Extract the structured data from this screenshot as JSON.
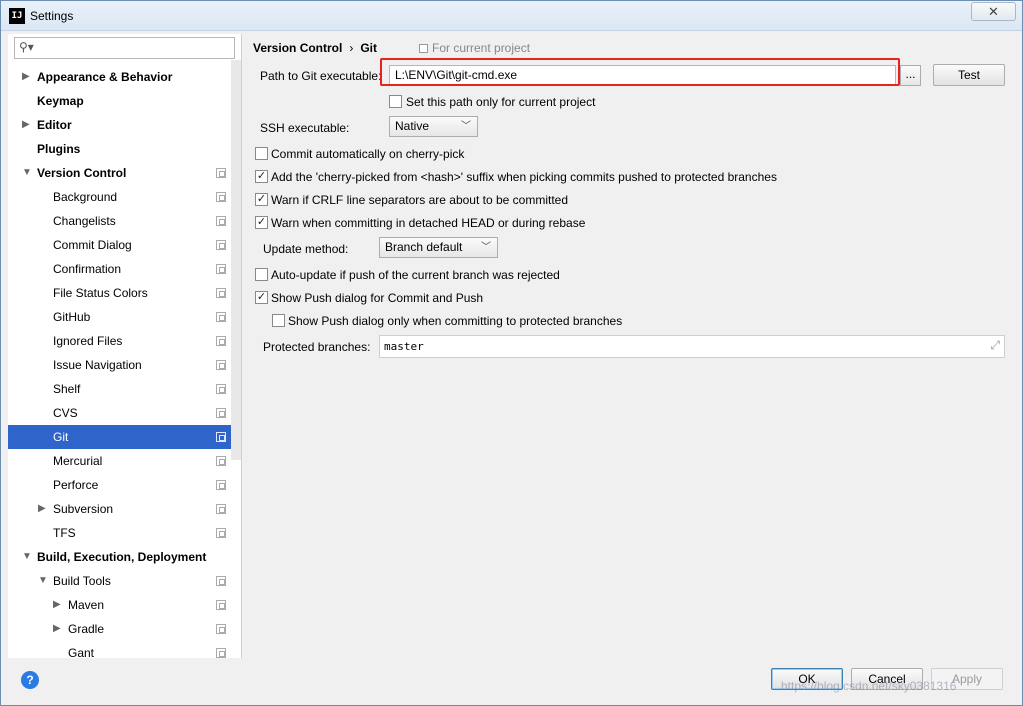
{
  "window": {
    "title": "Settings",
    "app_icon": "IJ",
    "close": "✕"
  },
  "sidebar": {
    "search_placeholder": "",
    "items": [
      {
        "label": "Appearance & Behavior",
        "bold": true,
        "arrow": "▶",
        "level": 0
      },
      {
        "label": "Keymap",
        "bold": true,
        "arrow": "",
        "level": 0
      },
      {
        "label": "Editor",
        "bold": true,
        "arrow": "▶",
        "level": 0
      },
      {
        "label": "Plugins",
        "bold": true,
        "arrow": "",
        "level": 0
      },
      {
        "label": "Version Control",
        "bold": true,
        "arrow": "▼",
        "level": 0,
        "project": true
      },
      {
        "label": "Background",
        "level": 1,
        "project": true
      },
      {
        "label": "Changelists",
        "level": 1,
        "project": true
      },
      {
        "label": "Commit Dialog",
        "level": 1,
        "project": true
      },
      {
        "label": "Confirmation",
        "level": 1,
        "project": true
      },
      {
        "label": "File Status Colors",
        "level": 1,
        "project": true
      },
      {
        "label": "GitHub",
        "level": 1,
        "project": true
      },
      {
        "label": "Ignored Files",
        "level": 1,
        "project": true
      },
      {
        "label": "Issue Navigation",
        "level": 1,
        "project": true
      },
      {
        "label": "Shelf",
        "level": 1,
        "project": true
      },
      {
        "label": "CVS",
        "level": 1,
        "project": true
      },
      {
        "label": "Git",
        "level": 1,
        "project": true,
        "selected": true
      },
      {
        "label": "Mercurial",
        "level": 1,
        "project": true
      },
      {
        "label": "Perforce",
        "level": 1,
        "project": true
      },
      {
        "label": "Subversion",
        "level": 1,
        "arrow": "▶",
        "project": true
      },
      {
        "label": "TFS",
        "level": 1,
        "project": true
      },
      {
        "label": "Build, Execution, Deployment",
        "bold": true,
        "arrow": "▼",
        "level": 0
      },
      {
        "label": "Build Tools",
        "level": 1,
        "arrow": "▼",
        "project": true
      },
      {
        "label": "Maven",
        "level": 2,
        "arrow": "▶",
        "project": true
      },
      {
        "label": "Gradle",
        "level": 2,
        "arrow": "▶",
        "project": true
      },
      {
        "label": "Gant",
        "level": 2,
        "project": true
      }
    ]
  },
  "main": {
    "breadcrumb": {
      "parent": "Version Control",
      "sep": "›",
      "current": "Git"
    },
    "for_project": "For current project",
    "path_label": "Path to Git executable:",
    "path_value": "L:\\ENV\\Git\\git-cmd.exe",
    "browse_label": "...",
    "test_label": "Test",
    "set_path_only": {
      "label": "Set this path only for current project",
      "checked": false
    },
    "ssh_label": "SSH executable:",
    "ssh_value": "Native",
    "options": [
      {
        "label": "Commit automatically on cherry-pick",
        "checked": false
      },
      {
        "label": "Add the 'cherry-picked from <hash>' suffix when picking commits pushed to protected branches",
        "checked": true
      },
      {
        "label": "Warn if CRLF line separators are about to be committed",
        "checked": true
      },
      {
        "label": "Warn when committing in detached HEAD or during rebase",
        "checked": true
      }
    ],
    "update_method_label": "Update method:",
    "update_method_value": "Branch default",
    "auto_update": {
      "label": "Auto-update if push of the current branch was rejected",
      "checked": false
    },
    "show_push": {
      "label": "Show Push dialog for Commit and Push",
      "checked": true
    },
    "show_push_protected": {
      "label": "Show Push dialog only when committing to protected branches",
      "checked": false
    },
    "protected_label": "Protected branches:",
    "protected_value": "master"
  },
  "footer": {
    "help": "?",
    "ok": "OK",
    "cancel": "Cancel",
    "apply": "Apply",
    "watermark": "https://blog.csdn.net/sky0381316"
  }
}
